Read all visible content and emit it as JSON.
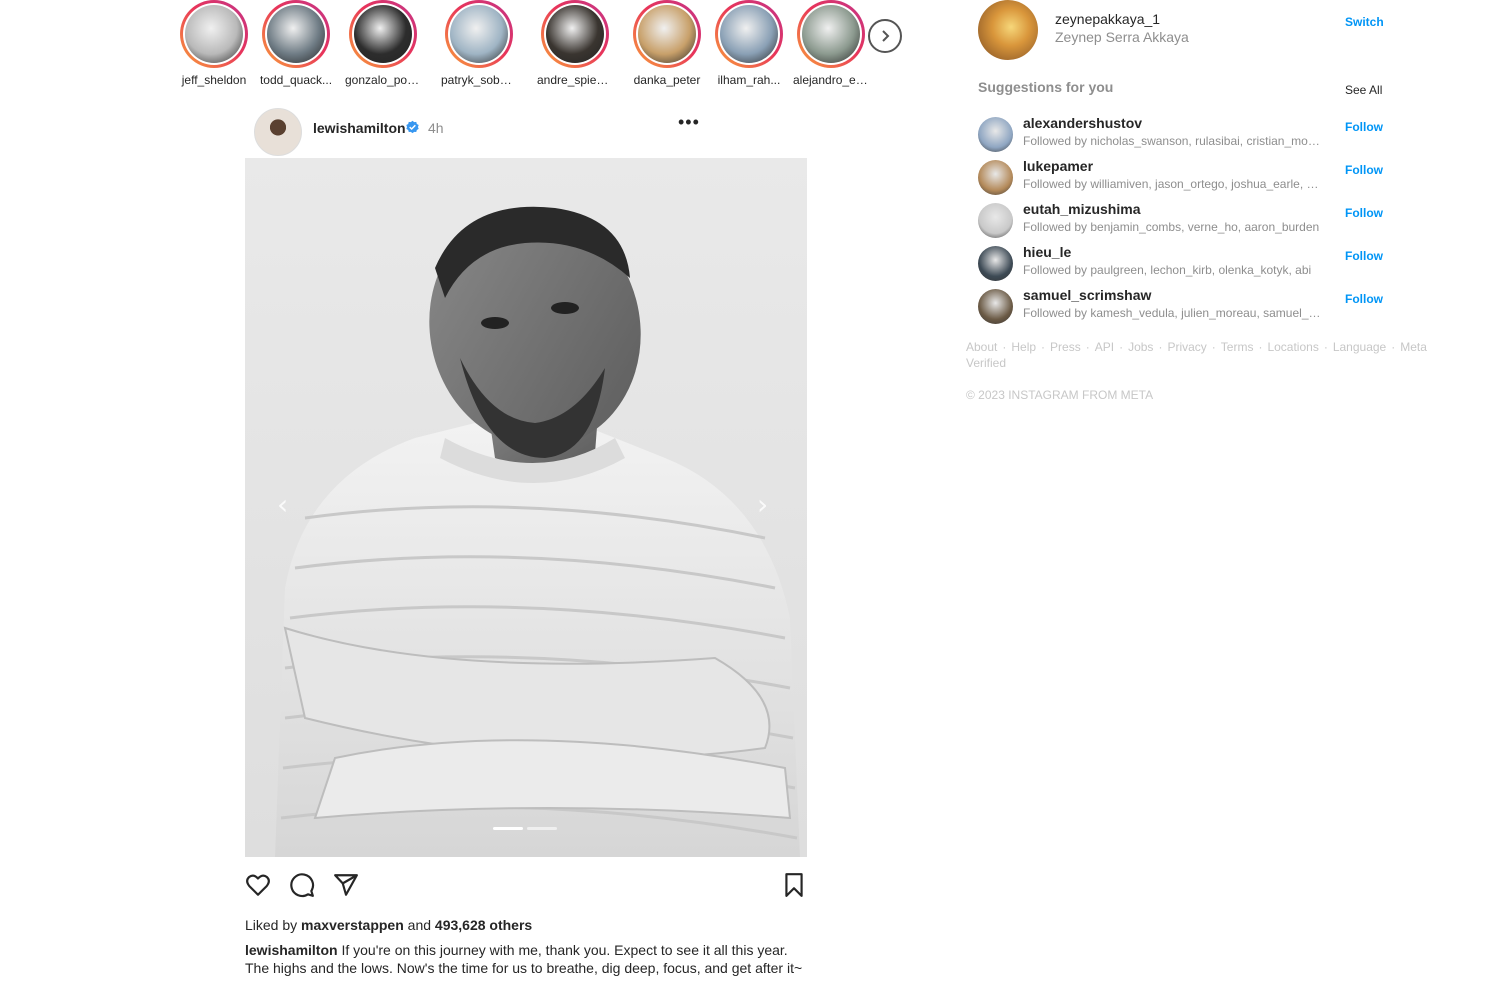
{
  "stories": [
    {
      "name": "jeff_sheldon",
      "color": "#b9b9b9"
    },
    {
      "name": "todd_quack...",
      "color": "#6f7c85"
    },
    {
      "name": "gonzalo_pob...",
      "color": "#2d2d2d"
    },
    {
      "name": "patryk_sobczak",
      "color": "#9fb4c4"
    },
    {
      "name": "andre_spieker",
      "color": "#3a3530"
    },
    {
      "name": "danka_peter",
      "color": "#c8a06a"
    },
    {
      "name": "ilham_rah...",
      "color": "#8aa0b5"
    },
    {
      "name": "alejandro_es...",
      "color": "#8c9a8f"
    }
  ],
  "post": {
    "username": "lewishamilton",
    "time": "4h",
    "more": "•••",
    "liked_prefix": "Liked by",
    "liked_user": "maxverstappen",
    "liked_and": "and",
    "liked_count": "493,628 others",
    "caption_user": "lewishamilton",
    "caption_text": "If you're on this journey with me, thank you. Expect to see it all this year. The highs and the lows. Now's the time for us to breathe, dig deep, focus, and get after it~",
    "carousel_prev": "‹",
    "carousel_next": "›"
  },
  "sidebar": {
    "me_username": "zeynepakkaya_1",
    "me_name": "Zeynep Serra Akkaya",
    "switch": "Switch",
    "suggestions_title": "Suggestions for you",
    "see_all": "See All",
    "suggestions": [
      {
        "user": "alexandershustov",
        "sub": "Followed by nicholas_swanson, rulasibai, cristian_moscoso",
        "action": "Follow",
        "color": "#8fa6c2"
      },
      {
        "user": "lukepamer",
        "sub": "Followed by williamiven, jason_ortego, joshua_earle, jon",
        "action": "Follow",
        "color": "#b48a5a"
      },
      {
        "user": "eutah_mizushima",
        "sub": "Followed by benjamin_combs, verne_ho, aaron_burden",
        "action": "Follow",
        "color": "#c9c9c9"
      },
      {
        "user": "hieu_le",
        "sub": "Followed by paulgreen, lechon_kirb, olenka_kotyk, abi",
        "action": "Follow",
        "color": "#3d4a55"
      },
      {
        "user": "samuel_scrimshaw",
        "sub": "Followed by kamesh_vedula, julien_moreau, samuel_zeller",
        "action": "Follow",
        "color": "#6b5a45"
      }
    ],
    "footer_links": [
      "About",
      "Help",
      "Press",
      "API",
      "Jobs",
      "Privacy",
      "Terms",
      "Locations",
      "Language",
      "Meta Verified"
    ],
    "footer_sep": "·",
    "copyright": "© 2023 INSTAGRAM FROM META"
  }
}
